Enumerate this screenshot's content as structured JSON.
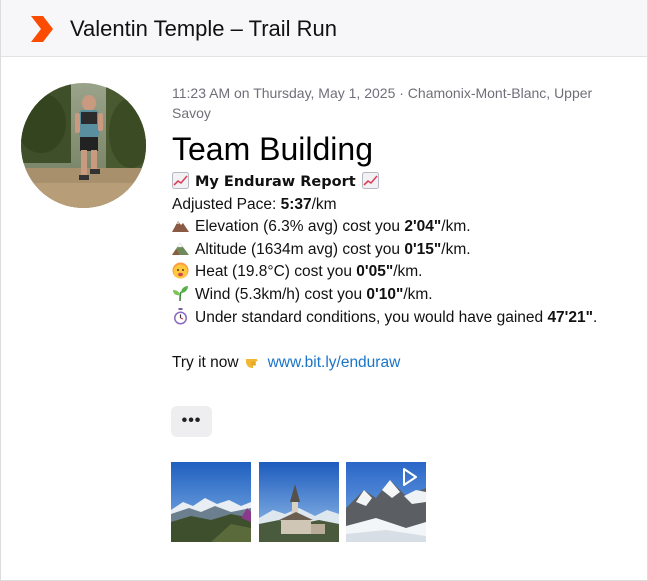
{
  "header": {
    "title": "Valentin Temple – Trail Run",
    "logo_icon": "strava-chevron-icon",
    "accent": "#fc4c02"
  },
  "post": {
    "meta": "11:23 AM on Thursday, May 1, 2025 · Chamonix-Mont-Blanc, Upper Savoy",
    "title": "Team Building",
    "report": {
      "icon": "chart-increasing-icon",
      "name": "My Enduraw Report"
    },
    "pace": {
      "label": "Adjusted Pace:",
      "value": "5:37",
      "unit": "/km"
    },
    "lines": [
      {
        "icon": "mountain-icon",
        "text": "Elevation (6.3% avg) cost you",
        "value": "2'04\"",
        "unit": "/km."
      },
      {
        "icon": "snow-mountain-icon",
        "text": "Altitude (1634m avg) cost you",
        "value": "0'15\"",
        "unit": "/km."
      },
      {
        "icon": "hot-face-icon",
        "text": "Heat (19.8°C) cost you",
        "value": "0'05\"",
        "unit": "/km."
      },
      {
        "icon": "seedling-icon",
        "text": "Wind (5.3km/h) cost you",
        "value": "0'10\"",
        "unit": "/km."
      }
    ],
    "standard": {
      "icon": "stopwatch-icon",
      "text": "Under standard conditions, you would have gained",
      "value": "47'21\"",
      "suffix": "."
    },
    "cta": {
      "text": "Try it now",
      "icon": "pointing-hand-icon",
      "link": "www.bit.ly/enduraw"
    },
    "more_label": "•••",
    "link_color": "#1a74c8"
  },
  "photos": [
    {
      "name": "photo-mountain-valley",
      "has_play": false
    },
    {
      "name": "photo-village-church",
      "has_play": false
    },
    {
      "name": "photo-snow-peak",
      "has_play": true
    }
  ]
}
